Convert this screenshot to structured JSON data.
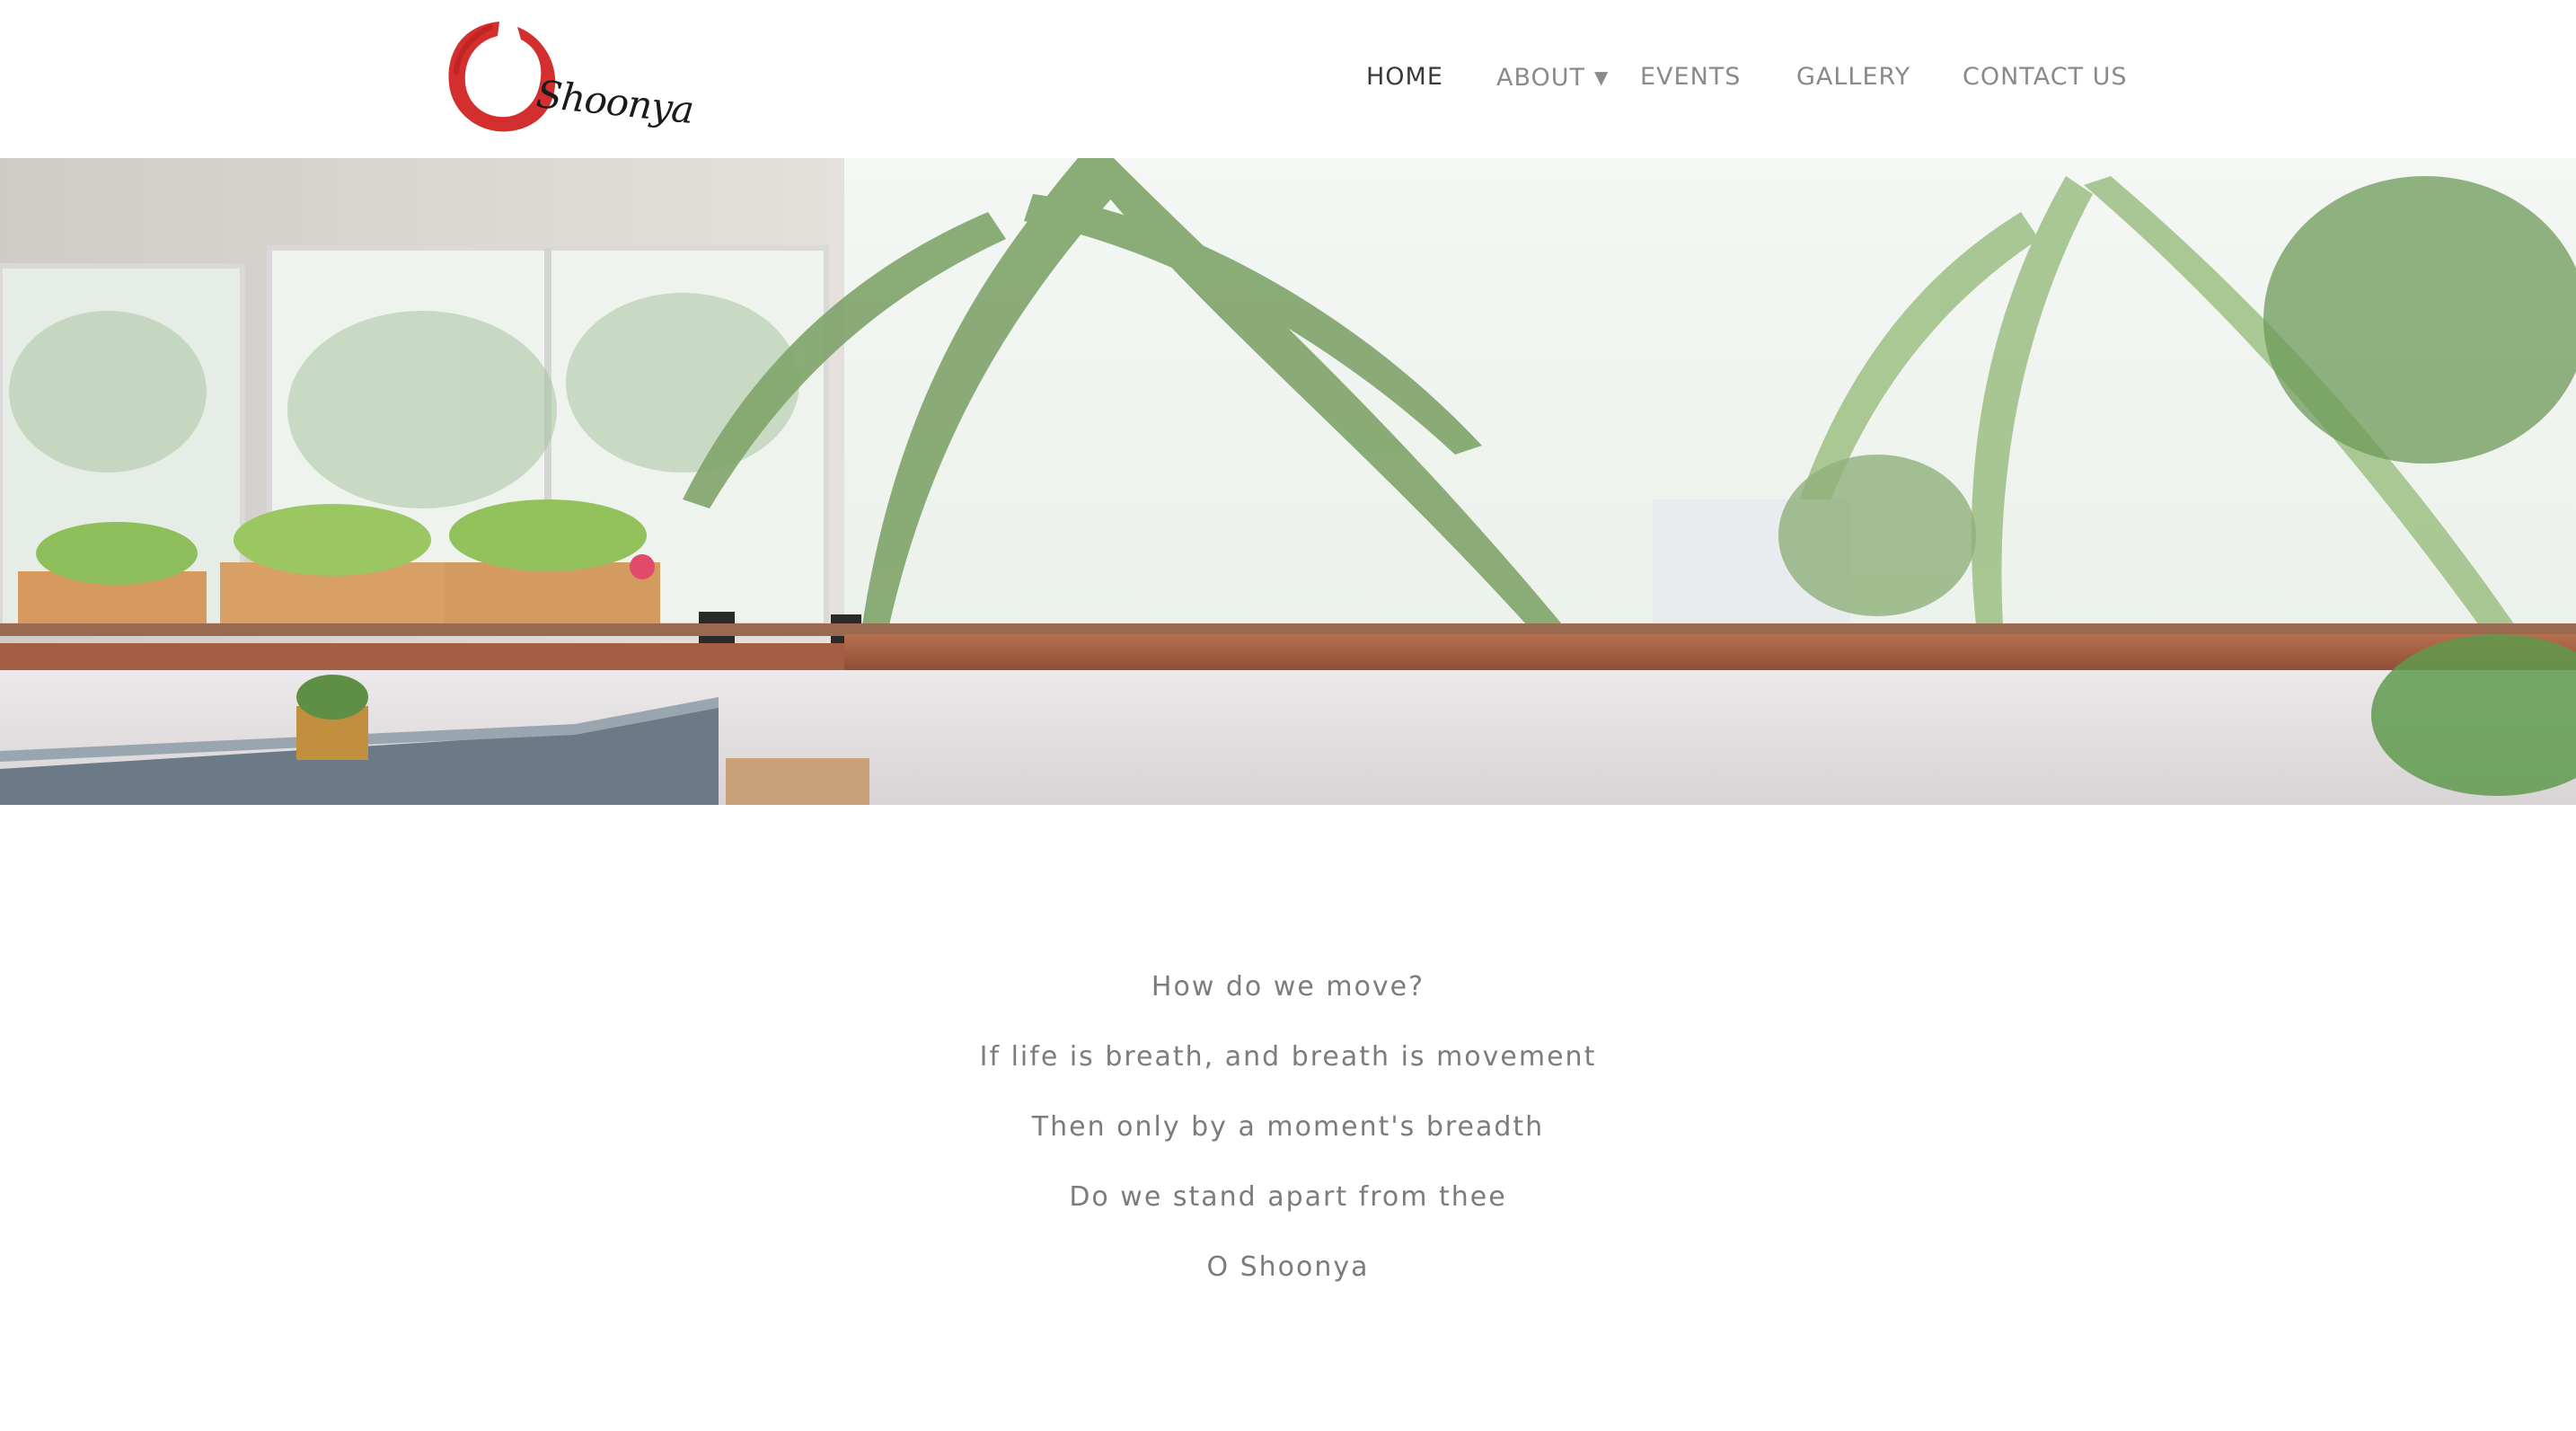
{
  "header": {
    "logo": {
      "text": "Shoonya",
      "ring_color": "#d32f2f",
      "icon": "enso-circle-logo"
    },
    "nav": [
      {
        "label": "HOME",
        "active": true
      },
      {
        "label": "ABOUT",
        "active": false,
        "has_dropdown": true,
        "dropdown_icon": "caret-down-icon"
      },
      {
        "label": "EVENTS",
        "active": false
      },
      {
        "label": "GALLERY",
        "active": false
      },
      {
        "label": "CONTACT US",
        "active": false
      }
    ]
  },
  "hero": {
    "image": "hero-photo-balcony-palms"
  },
  "poem": {
    "lines": [
      "How do we move?",
      "If life is breath, and breath is movement",
      "Then only by a moment's breadth",
      "Do we stand apart from thee",
      "O Shoonya"
    ]
  },
  "colors": {
    "nav_text": "#8a8a8a",
    "nav_active": "#3a3a3a",
    "body_text": "#7c7c7c",
    "accent_red": "#d32f2f",
    "background": "#ffffff"
  }
}
